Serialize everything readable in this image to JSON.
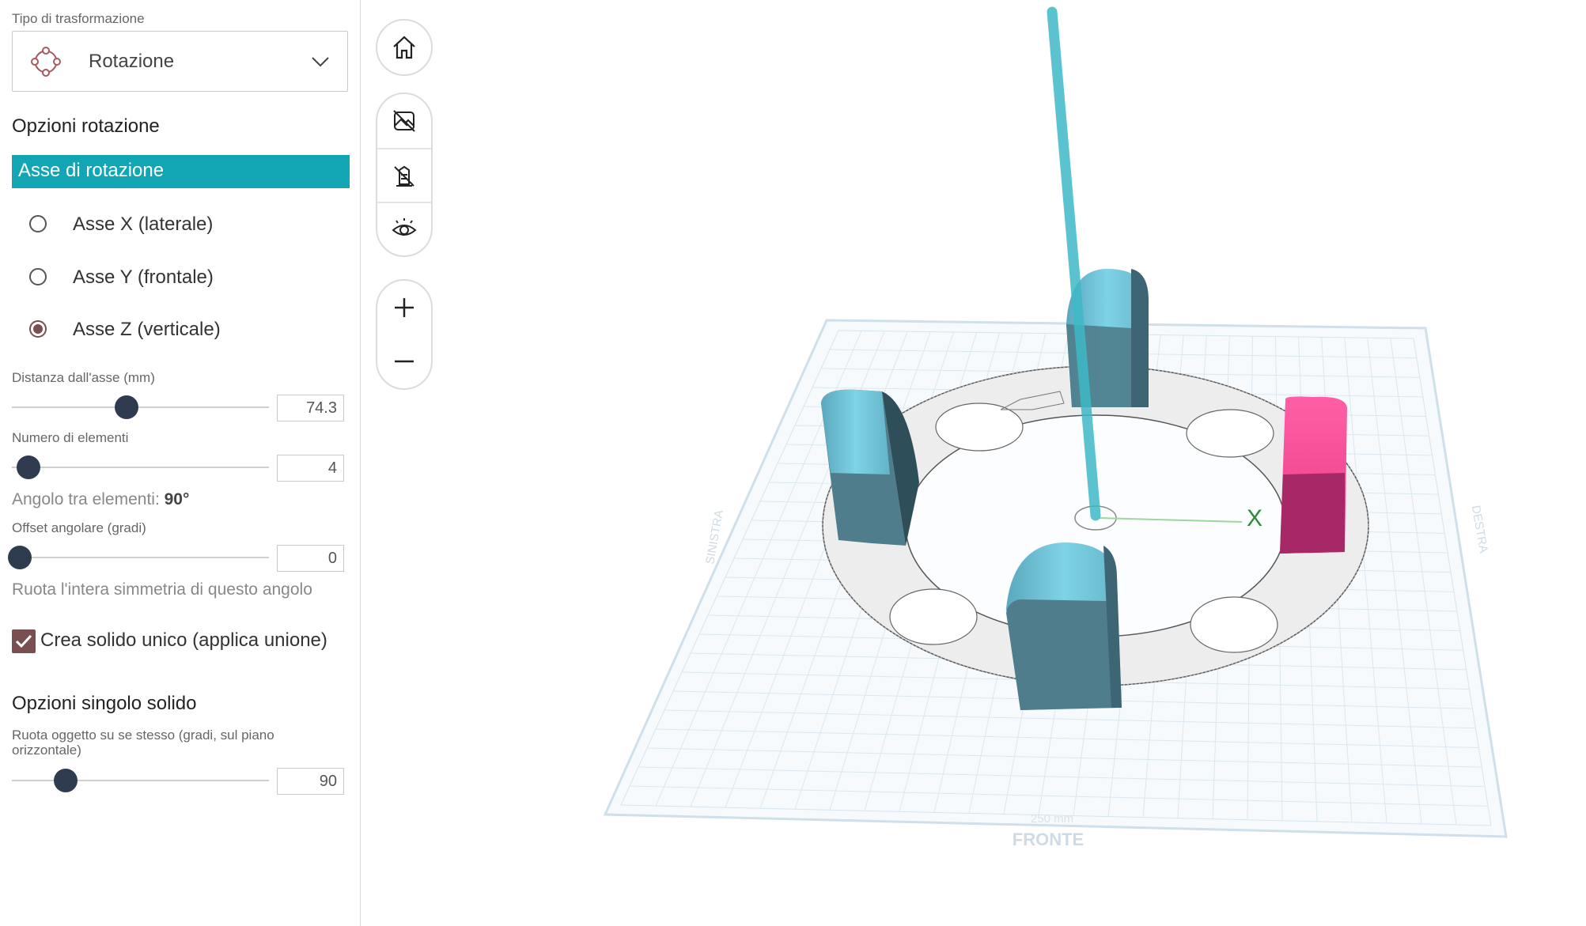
{
  "panel": {
    "transform_type_label": "Tipo di trasformazione",
    "transform_select": {
      "value": "Rotazione",
      "icon": "rotate-nodes-icon"
    },
    "rotation_options_title": "Opzioni rotazione",
    "axis_header": "Asse di rotazione",
    "axes": [
      {
        "label": "Asse X (laterale)",
        "selected": false
      },
      {
        "label": "Asse Y (frontale)",
        "selected": false
      },
      {
        "label": "Asse Z (verticale)",
        "selected": true
      }
    ],
    "distance": {
      "label": "Distanza dall'asse (mm)",
      "value": "74.3",
      "slider_fraction": 0.445
    },
    "count": {
      "label": "Numero di elementi",
      "value": "4",
      "slider_fraction": 0.065
    },
    "angle_between": {
      "label": "Angolo tra elementi:",
      "value": "90°"
    },
    "angular_offset": {
      "label": "Offset angolare (gradi)",
      "value": "0",
      "slider_fraction": 0.03,
      "hint": "Ruota l'intera simmetria di questo angolo"
    },
    "single_solid_checkbox": {
      "label": "Crea solido unico (applica unione)",
      "checked": true
    },
    "single_solid_title": "Opzioni singolo solido",
    "self_rotation": {
      "label": "Ruota oggetto su se stesso (gradi, sul piano orizzontale)",
      "value": "90",
      "slider_fraction": 0.21
    }
  },
  "toolbar": {
    "home": "home-icon",
    "hide_selected": "hide-image-icon",
    "hide_others": "hide-object-icon",
    "show_all": "eye-icon",
    "zoom_in": "plus-icon",
    "zoom_out": "minus-icon"
  },
  "viewport": {
    "plate_labels": {
      "front": "FRONTE",
      "left": "SINISTRA",
      "right": "DESTRA",
      "size": "250 mm"
    },
    "axis_label": "X",
    "colors": {
      "accent": "#12a5b4",
      "selected_object": "#e83b85",
      "objects": "#4d7c8a",
      "axis": "#3fb9c7"
    }
  }
}
